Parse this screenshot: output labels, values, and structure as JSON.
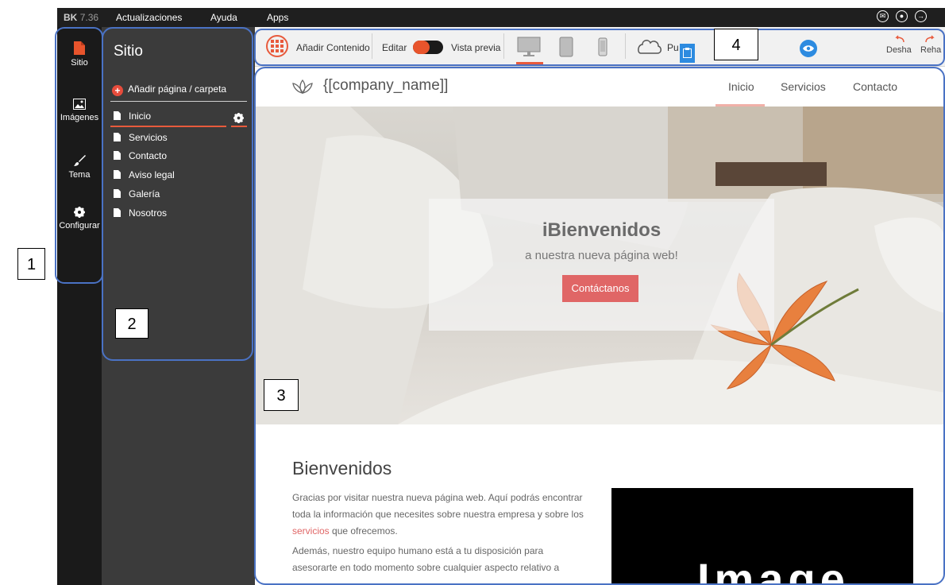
{
  "topbar": {
    "version_prefix": "BK",
    "version": "7.36",
    "menus": [
      "Actualizaciones",
      "Ayuda",
      "Apps"
    ],
    "right_icons": [
      "mail-icon",
      "user-icon",
      "logout-icon"
    ]
  },
  "leftnav": {
    "items": [
      {
        "label": "Sitio",
        "icon": "file-icon"
      },
      {
        "label": "Imágenes",
        "icon": "image-icon"
      },
      {
        "label": "Tema",
        "icon": "brush-icon"
      },
      {
        "label": "Configurar",
        "icon": "gear-icon"
      }
    ]
  },
  "sitepanel": {
    "title": "Sitio",
    "add_page": "Añadir página / carpeta",
    "pages": [
      "Inicio",
      "Servicios",
      "Contacto",
      "Aviso legal",
      "Galería",
      "Nosotros"
    ]
  },
  "toolbar": {
    "add_content": "Añadir Contenido",
    "edit": "Editar",
    "preview": "Vista previa",
    "publish": "Pu",
    "undo": "Desha",
    "redo": "Reha"
  },
  "site": {
    "company": "{[company_name]]",
    "nav": [
      "Inicio",
      "Servicios",
      "Contacto"
    ],
    "hero_title": "iBienvenidos",
    "hero_subtitle": "a nuestra nueva página web!",
    "hero_button": "Contáctanos",
    "welcome_heading": "Bienvenidos",
    "para1_before": "Gracias por visitar nuestra nueva página web. Aquí podrás encontrar toda la información que necesites sobre nuestra empresa y sobre los ",
    "para1_link": "servicios",
    "para1_after": " que ofrecemos.",
    "para2": "Además, nuestro equipo humano está a tu disposición para asesorarte en todo momento sobre cualquier aspecto relativo a",
    "image_placeholder": "Image"
  },
  "annotations": [
    "1",
    "2",
    "3",
    "4"
  ],
  "colors": {
    "accent": "#e85a3c",
    "annotation_blue": "#4a72c4",
    "toolbar_blue": "#2d8be0"
  }
}
